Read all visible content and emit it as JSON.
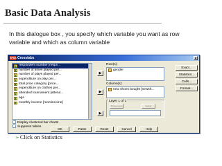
{
  "slide": {
    "title": "Basic Data Analysis",
    "intro": "In this dialogue box , you specify which variable you want as row variable and which as column variable",
    "bullet_text": "Click on Statistics"
  },
  "dialog": {
    "title": "Crosstabs",
    "app_badge": "SPSS",
    "variables": [
      "respondent number [respn...",
      "number of times played per...",
      "number of plays played per...",
      "expenditure on play per...",
      "total price category [price...",
      "expenditure on clothes per...",
      "attended tournament [attend...",
      "age",
      "monthly income [montincome]"
    ],
    "selected_index": 0,
    "rows_label": "Row(s):",
    "rows_items": [
      "gender"
    ],
    "columns_label": "Column(s):",
    "columns_items": [
      "new shoes bought [newsh..."
    ],
    "layer_label": "Layer 1 of 1",
    "previous_label": "Previous",
    "next_label": "Next",
    "side_buttons": [
      "Exact...",
      "Statistics...",
      "Cells...",
      "Format..."
    ],
    "checkboxes": [
      "Display clustered bar charts",
      "Suppress tables"
    ],
    "bottom_buttons": [
      "OK",
      "Paste",
      "Reset",
      "Cancel",
      "Help"
    ],
    "arrow_glyph": "▶",
    "close_glyph": "×"
  },
  "colors": {
    "selection": "#0a246a",
    "dialog_bg": "#ece9d8",
    "bullet": "#2f7d2f"
  }
}
